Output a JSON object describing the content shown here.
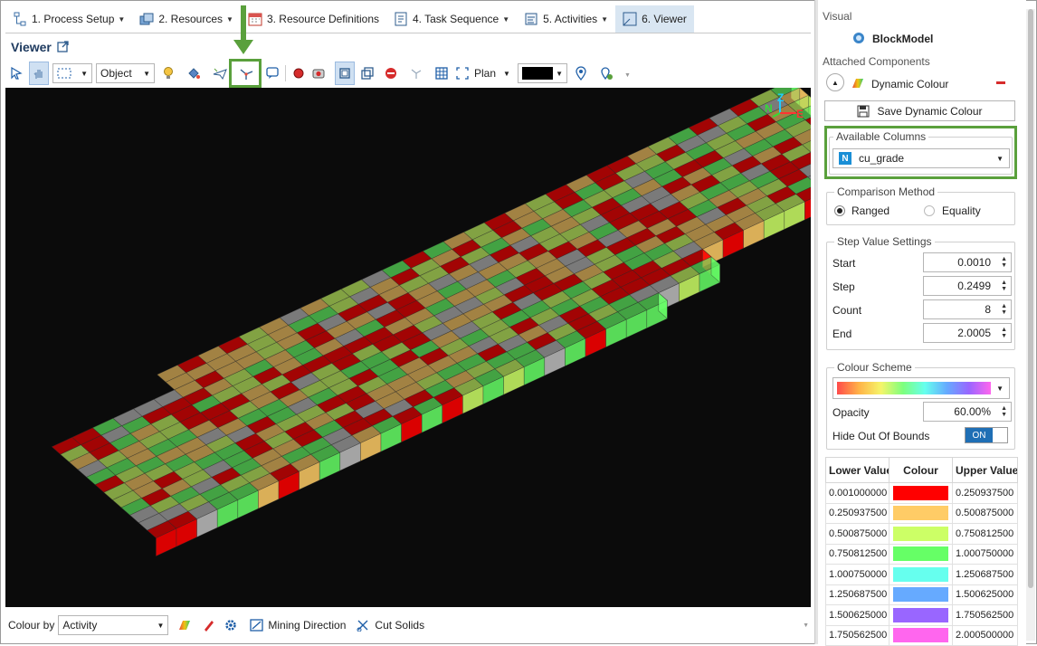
{
  "tabs": [
    {
      "label": "1. Process Setup",
      "has_dropdown": true,
      "icon": "process-setup-icon"
    },
    {
      "label": "2. Resources",
      "has_dropdown": true,
      "icon": "resources-icon"
    },
    {
      "label": "3. Resource Definitions",
      "has_dropdown": false,
      "icon": "calendar-icon"
    },
    {
      "label": "4. Task Sequence",
      "has_dropdown": true,
      "icon": "task-sequence-icon"
    },
    {
      "label": "5. Activities",
      "has_dropdown": true,
      "icon": "activities-icon"
    },
    {
      "label": "6. Viewer",
      "has_dropdown": false,
      "active": true,
      "icon": "viewer-icon"
    }
  ],
  "viewer": {
    "title": "Viewer"
  },
  "toolbar": {
    "object_select": "Object",
    "view_select": "Plan",
    "background_colour": "#000000"
  },
  "axes": {
    "north": "N",
    "up": "Z",
    "east": "E"
  },
  "bottom": {
    "colour_by_label": "Colour by",
    "colour_by_value": "Activity",
    "mining_direction": "Mining Direction",
    "cut_solids": "Cut Solids"
  },
  "panel": {
    "section": "Visual",
    "object_name": "BlockModel",
    "attached_label": "Attached Components",
    "component_name": "Dynamic Colour",
    "save_button": "Save Dynamic Colour",
    "available_columns": {
      "title": "Available Columns",
      "value": "cu_grade",
      "type_badge": "N"
    },
    "comparison": {
      "title": "Comparison Method",
      "options": [
        "Ranged",
        "Equality"
      ],
      "selected": "Ranged"
    },
    "step": {
      "title": "Step Value Settings",
      "start_label": "Start",
      "start": "0.0010",
      "step_label": "Step",
      "step": "0.2499",
      "count_label": "Count",
      "count": "8",
      "end_label": "End",
      "end": "2.0005"
    },
    "scheme": {
      "title": "Colour Scheme",
      "opacity_label": "Opacity",
      "opacity": "60.00%",
      "hide_label": "Hide Out Of Bounds",
      "hide_state": "ON"
    },
    "table": {
      "headers": [
        "Lower Value",
        "Colour",
        "Upper Value"
      ],
      "rows": [
        {
          "lower": "0.001000000",
          "colour": "#ff0000",
          "upper": "0.250937500"
        },
        {
          "lower": "0.250937500",
          "colour": "#ffcc66",
          "upper": "0.500875000"
        },
        {
          "lower": "0.500875000",
          "colour": "#ccff66",
          "upper": "0.750812500"
        },
        {
          "lower": "0.750812500",
          "colour": "#66ff66",
          "upper": "1.000750000"
        },
        {
          "lower": "1.000750000",
          "colour": "#66ffee",
          "upper": "1.250687500"
        },
        {
          "lower": "1.250687500",
          "colour": "#66aaff",
          "upper": "1.500625000"
        },
        {
          "lower": "1.500625000",
          "colour": "#9966ff",
          "upper": "1.750562500"
        },
        {
          "lower": "1.750562500",
          "colour": "#ff66ee",
          "upper": "2.000500000"
        }
      ]
    }
  }
}
